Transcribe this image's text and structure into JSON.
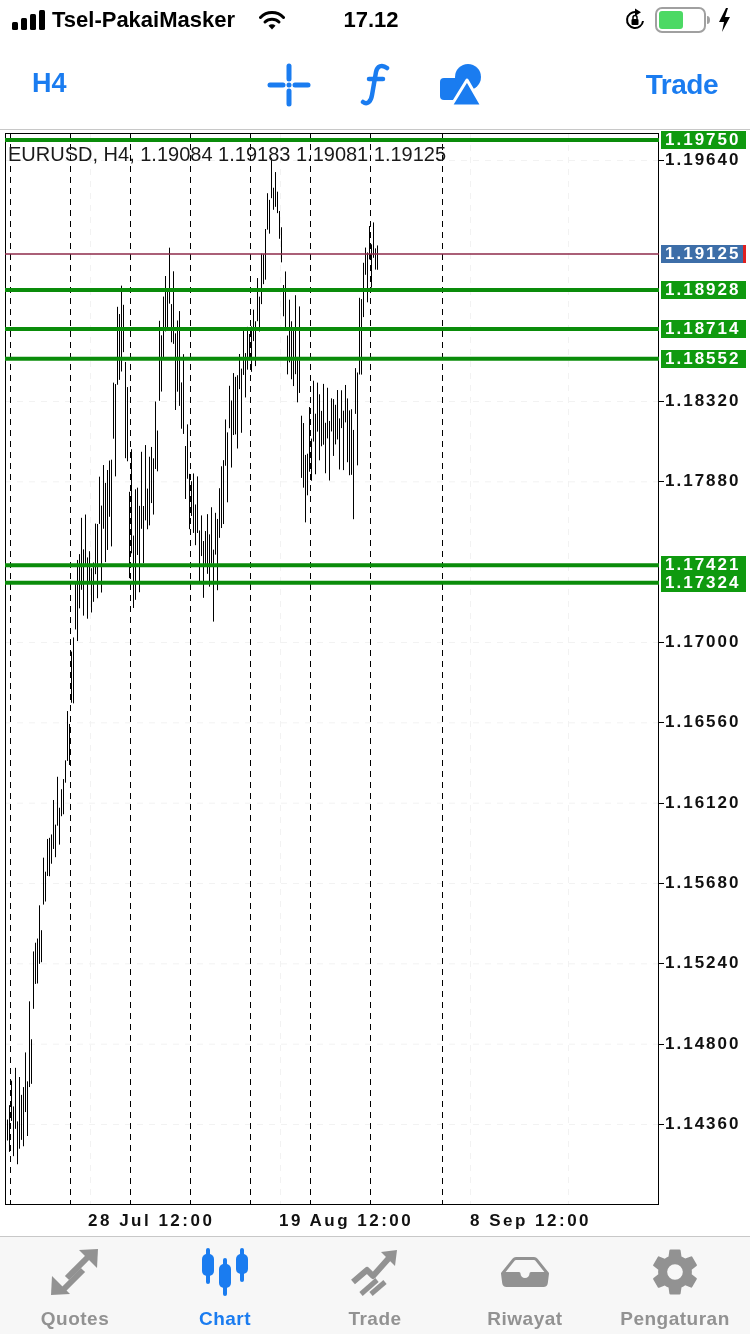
{
  "status_bar": {
    "carrier": "Tsel-PakaiMasker",
    "time": "17.12"
  },
  "toolbar": {
    "timeframe": "H4",
    "trade_button": "Trade"
  },
  "chart": {
    "header": "EURUSD, H4, 1.19084 1.19183 1.19081 1.19125",
    "price_ticks": [
      "1.19640",
      "1.18320",
      "1.17880",
      "1.17000",
      "1.16560",
      "1.16120",
      "1.15680",
      "1.15240",
      "1.14800",
      "1.14360"
    ],
    "levels": [
      {
        "price": "1.19750",
        "kind": "level"
      },
      {
        "price": "1.19125",
        "kind": "current"
      },
      {
        "price": "1.18928",
        "kind": "level"
      },
      {
        "price": "1.18714",
        "kind": "level"
      },
      {
        "price": "1.18552",
        "kind": "level"
      },
      {
        "price": "1.17421",
        "kind": "level"
      },
      {
        "price": "1.17324",
        "kind": "level"
      }
    ],
    "time_labels": [
      "28 Jul 12:00",
      "19 Aug 12:00",
      "8 Sep 12:00"
    ]
  },
  "tab_bar": [
    {
      "label": "Quotes",
      "selected": false
    },
    {
      "label": "Chart",
      "selected": true
    },
    {
      "label": "Trade",
      "selected": false
    },
    {
      "label": "Riwayat",
      "selected": false
    },
    {
      "label": "Pengaturan",
      "selected": false
    }
  ]
}
